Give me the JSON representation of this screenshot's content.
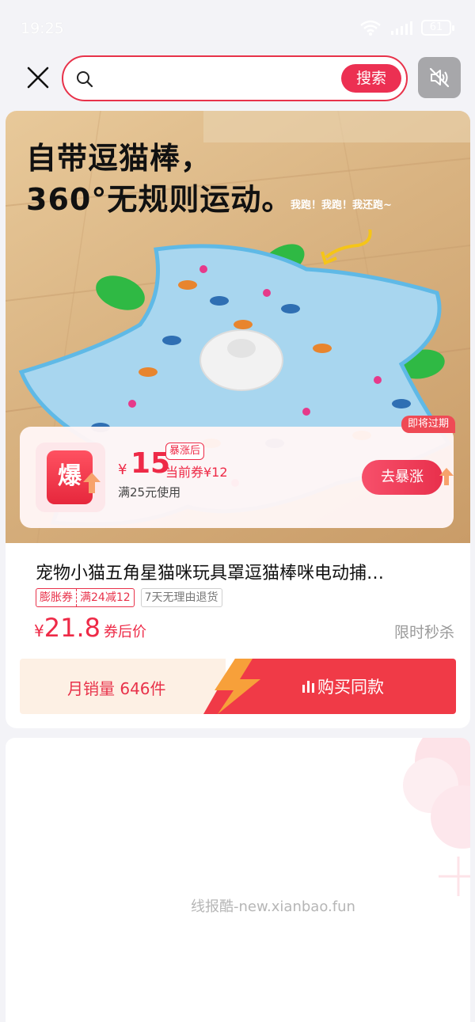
{
  "status_bar": {
    "time": "19:25",
    "battery": "61"
  },
  "search": {
    "placeholder": "",
    "button_label": "搜索"
  },
  "product": {
    "headline": "自带逗猫棒，\n360°无规则运动。",
    "speech_note": "我跑！我跑！我还跑~",
    "coupon": {
      "expire_tag": "即将过期",
      "badge_text": "爆",
      "currency": "¥",
      "amount": "15",
      "after_surge_label": "暴涨后",
      "current_coupon": "当前券¥12",
      "condition": "满25元使用",
      "surge_button": "去暴涨"
    },
    "title": "宠物小猫五角星猫咪玩具罩逗猫棒咪电动捕…",
    "tags": {
      "coupon_type": "膨胀券",
      "coupon_rule": "满24减12",
      "return_policy": "7天无理由退货"
    },
    "price_currency": "¥",
    "price_value": "21.8",
    "price_note": "券后价",
    "flash_sale": "限时秒杀",
    "monthly_sales": "月销量 646件",
    "buy_label": "购买同款"
  },
  "footer": {
    "watermark": "线报酷-new.xianbao.fun"
  },
  "colors": {
    "accent": "#ec3052",
    "mat_blue": "#a8d6ef",
    "feather_green": "#2fb944"
  }
}
